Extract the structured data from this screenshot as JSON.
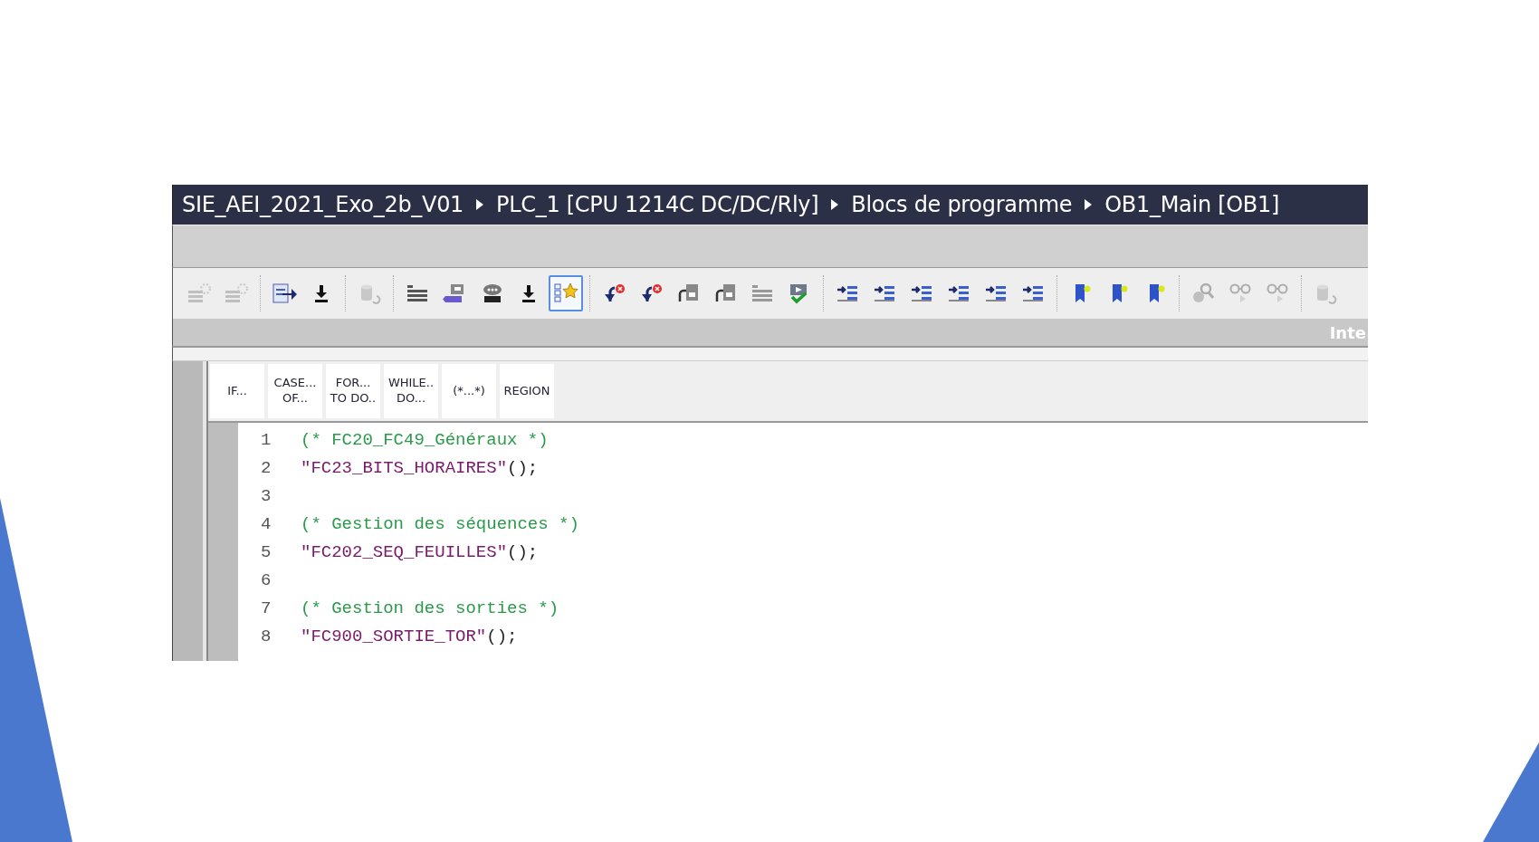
{
  "breadcrumb": [
    "SIE_AEI_2021_Exo_2b_V01",
    "PLC_1 [CPU 1214C DC/DC/Rly]",
    "Blocs de programme",
    "OB1_Main [OB1]"
  ],
  "toolbar": [
    [
      {
        "kind": "gear",
        "disabled": true,
        "selected": false
      },
      {
        "kind": "gear",
        "disabled": true,
        "selected": false
      }
    ],
    [
      {
        "kind": "doc-arrow",
        "disabled": false,
        "selected": false
      },
      {
        "kind": "download",
        "disabled": false,
        "selected": false
      }
    ],
    [
      {
        "kind": "cylinder",
        "disabled": true,
        "selected": false
      }
    ],
    [
      {
        "kind": "lines",
        "disabled": false,
        "selected": false
      },
      {
        "kind": "tag",
        "disabled": false,
        "selected": false
      },
      {
        "kind": "chat",
        "disabled": false,
        "selected": false
      },
      {
        "kind": "download",
        "disabled": false,
        "selected": false
      },
      {
        "kind": "star",
        "disabled": false,
        "selected": true
      }
    ],
    [
      {
        "kind": "undo-x",
        "disabled": false,
        "selected": false
      },
      {
        "kind": "undo-x",
        "disabled": false,
        "selected": false
      },
      {
        "kind": "doc",
        "disabled": false,
        "selected": false
      },
      {
        "kind": "doc",
        "disabled": false,
        "selected": false
      },
      {
        "kind": "lines",
        "disabled": true,
        "selected": false
      },
      {
        "kind": "check",
        "disabled": false,
        "selected": false
      }
    ],
    [
      {
        "kind": "indent",
        "disabled": false,
        "selected": false
      },
      {
        "kind": "indent",
        "disabled": false,
        "selected": false
      },
      {
        "kind": "indent",
        "disabled": false,
        "selected": false
      },
      {
        "kind": "indent",
        "disabled": false,
        "selected": false
      },
      {
        "kind": "indent",
        "disabled": false,
        "selected": false
      },
      {
        "kind": "indent",
        "disabled": false,
        "selected": false
      }
    ],
    [
      {
        "kind": "bookmark",
        "disabled": false,
        "selected": false
      },
      {
        "kind": "bookmark",
        "disabled": false,
        "selected": false
      },
      {
        "kind": "bookmark",
        "disabled": false,
        "selected": false
      }
    ],
    [
      {
        "kind": "search",
        "disabled": true,
        "selected": false
      },
      {
        "kind": "glasses",
        "disabled": true,
        "selected": false
      },
      {
        "kind": "glasses",
        "disabled": true,
        "selected": false
      }
    ],
    [
      {
        "kind": "cylinder",
        "disabled": true,
        "selected": false
      }
    ]
  ],
  "panel_label": "Inte",
  "snippets": [
    "IF...",
    "CASE...\nOF...",
    "FOR...\nTO DO..",
    "WHILE..\nDO...",
    "(*...*)",
    "REGION"
  ],
  "code": [
    {
      "number": "1",
      "kind": "comment",
      "text": "(* FC20_FC49_Généraux *)"
    },
    {
      "number": "2",
      "kind": "call",
      "text": "\"FC23_BITS_HORAIRES\"",
      "args": "();"
    },
    {
      "number": "3",
      "kind": "empty"
    },
    {
      "number": "4",
      "kind": "comment",
      "text": "(* Gestion des séquences *)"
    },
    {
      "number": "5",
      "kind": "call",
      "text": "\"FC202_SEQ_FEUILLES\"",
      "args": "();"
    },
    {
      "number": "6",
      "kind": "empty"
    },
    {
      "number": "7",
      "kind": "comment",
      "text": "(* Gestion des sorties *)"
    },
    {
      "number": "8",
      "kind": "call",
      "text": "\"FC900_SORTIE_TOR\"",
      "args": "();"
    }
  ]
}
